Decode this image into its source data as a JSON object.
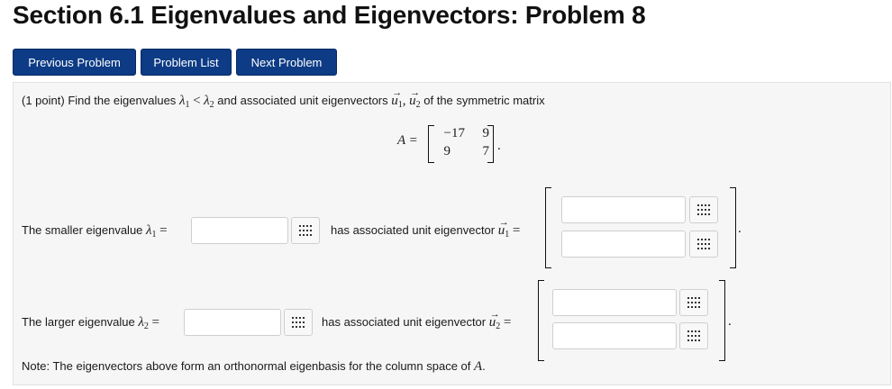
{
  "page": {
    "title": "Section 6.1 Eigenvalues and Eigenvectors: Problem 8"
  },
  "nav": {
    "previous_label": "Previous Problem",
    "list_label": "Problem List",
    "next_label": "Next Problem"
  },
  "problem": {
    "points": "(1 point)",
    "intro_text": "Find the eigenvalues",
    "lambda1": "λ",
    "sub1": "1",
    "lt": "<",
    "lambda2": "λ",
    "sub2": "2",
    "intro_text2": "and associated unit eigenvectors",
    "u": "u",
    "arrow": "→",
    "comma": ",",
    "intro_text3": "of the symmetric matrix",
    "matrix_label": "A =",
    "matrix": [
      [
        "−17",
        "9"
      ],
      [
        "9",
        "7"
      ]
    ],
    "period": "."
  },
  "row1": {
    "label_prefix": "The smaller eigenvalue",
    "equals": "=",
    "vector_text": "has associated unit eigenvector",
    "lambda_value": "",
    "vector_values": [
      "",
      ""
    ]
  },
  "row2": {
    "label_prefix": "The larger eigenvalue",
    "equals": "=",
    "vector_text": "has associated unit eigenvector",
    "lambda_value": "",
    "vector_values": [
      "",
      ""
    ]
  },
  "note": {
    "text": "Note: The eigenvectors above form an orthonormal eigenbasis for the column space of",
    "matrix_symbol": "A",
    "period": "."
  },
  "icons": {
    "matrix_entry": "grid-icon"
  }
}
